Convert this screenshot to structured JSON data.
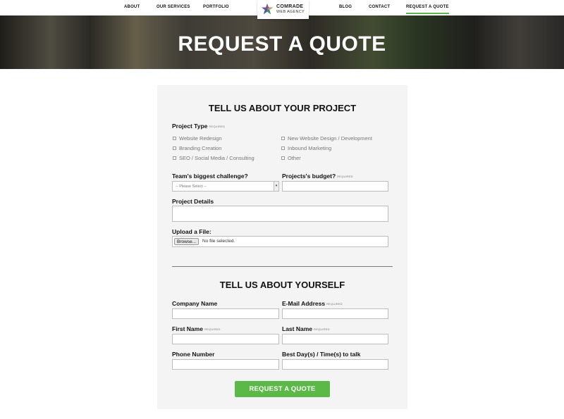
{
  "nav": {
    "items": [
      "ABOUT",
      "OUR SERVICES",
      "PORTFOLIO",
      "BLOG",
      "CONTACT",
      "REQUEST A QUOTE"
    ],
    "active": "REQUEST A QUOTE",
    "accent_color": "#5ab947"
  },
  "logo": {
    "line1": "COMRADE",
    "line2": "WEB AGENCY"
  },
  "hero": {
    "title": "REQUEST A QUOTE"
  },
  "project_section": {
    "title": "TELL US ABOUT YOUR PROJECT",
    "project_type": {
      "label": "Project Type",
      "required": "REQUIRED",
      "options": [
        "Website Redesign",
        "New Website Design / Development",
        "Branding Creation",
        "Inbound Marketing",
        "SEO / Social Media / Consulting",
        "Other"
      ]
    },
    "challenge": {
      "label": "Team's biggest challenge?",
      "selected": "-- Please Select --"
    },
    "budget": {
      "label": "Projects's budget?",
      "required": "REQUIRED",
      "value": ""
    },
    "details": {
      "label": "Project Details",
      "value": ""
    },
    "upload": {
      "label": "Upload a File:",
      "button": "Browse...",
      "status": "No file selected."
    }
  },
  "about_section": {
    "title": "TELL US ABOUT YOURSELF",
    "company": {
      "label": "Company Name",
      "value": ""
    },
    "email": {
      "label": "E-Mail Address",
      "required": "REQUIRED",
      "value": ""
    },
    "first_name": {
      "label": "First Name",
      "required": "REQUIRED",
      "value": ""
    },
    "last_name": {
      "label": "Last Name",
      "required": "REQUIRED",
      "value": ""
    },
    "phone": {
      "label": "Phone Number",
      "value": ""
    },
    "best_time": {
      "label": "Best Day(s) / Time(s) to talk",
      "value": ""
    }
  },
  "submit": {
    "label": "REQUEST A QUOTE",
    "color": "#5ab947"
  }
}
